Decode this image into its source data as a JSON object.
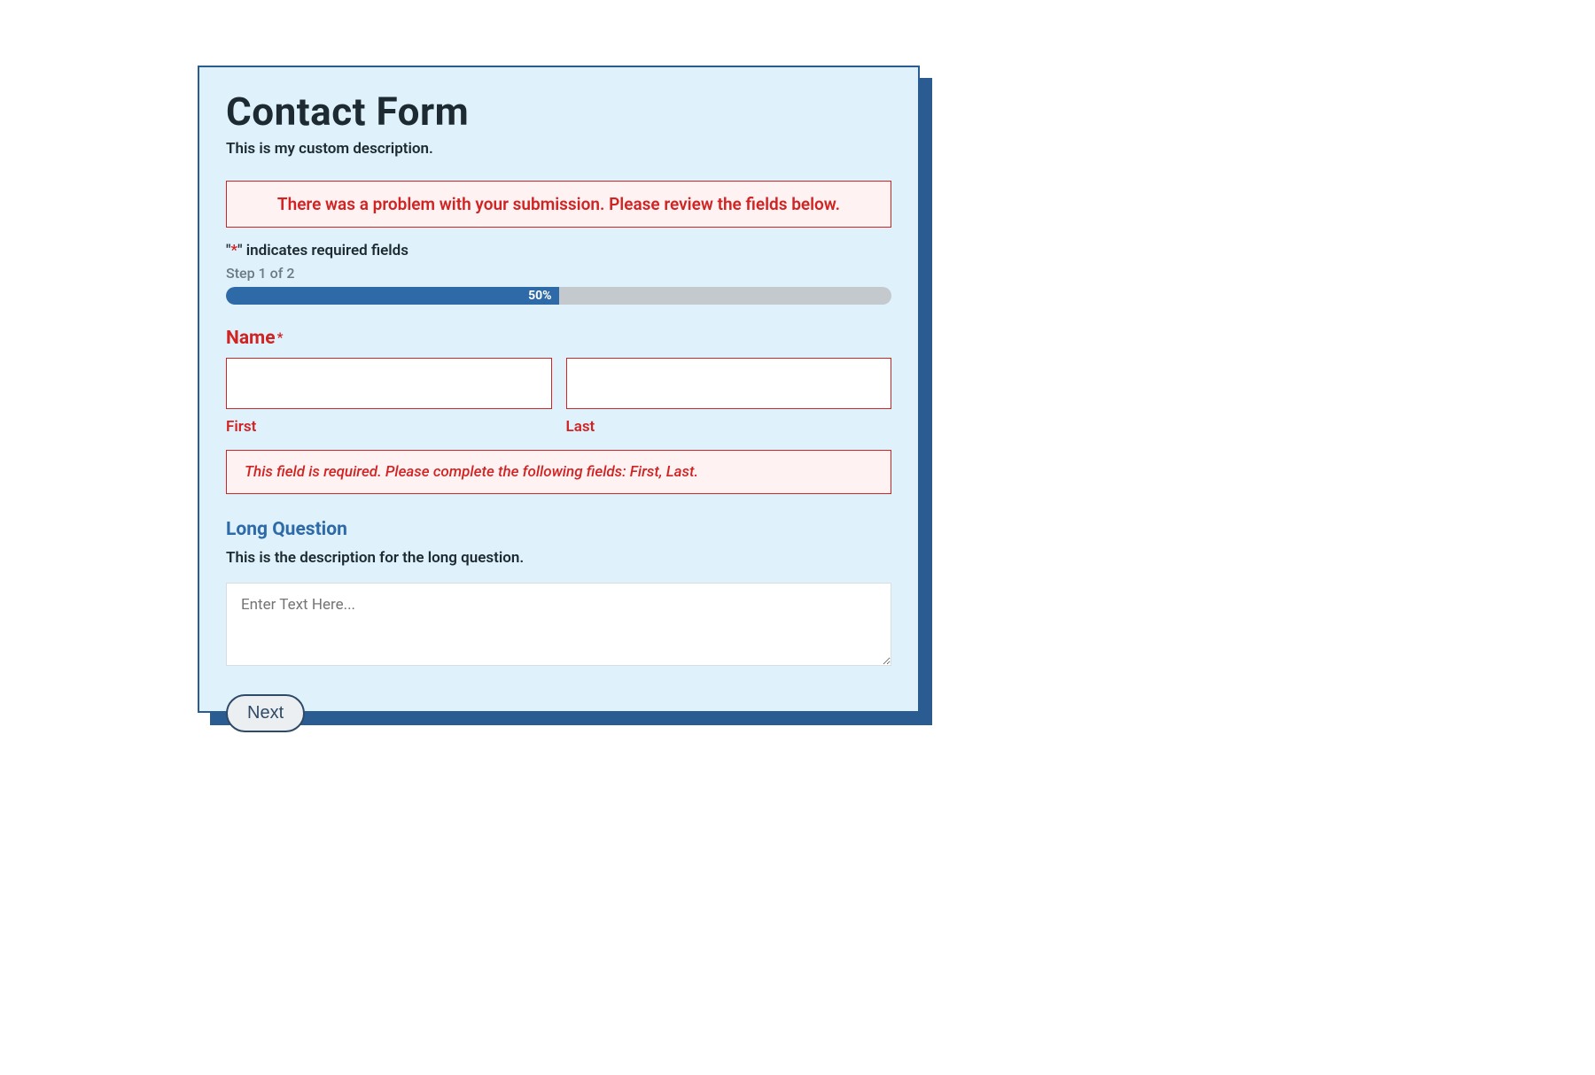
{
  "form": {
    "title": "Contact Form",
    "description": "This is my custom description.",
    "error_banner": "There was a problem with your submission. Please review the fields below.",
    "required_hint_prefix": "\"",
    "required_hint_star": "*",
    "required_hint_suffix": "\" indicates required fields",
    "step_label": "Step 1 of 2",
    "progress_percent": "50%",
    "name": {
      "label": "Name",
      "asterisk": "*",
      "first_value": "",
      "last_value": "",
      "first_sublabel": "First",
      "last_sublabel": "Last",
      "error": "This field is required. Please complete the following fields: First, Last."
    },
    "long": {
      "label": "Long Question",
      "description": "This is the description for the long question.",
      "placeholder": "Enter Text Here...",
      "value": ""
    },
    "next_label": "Next"
  }
}
